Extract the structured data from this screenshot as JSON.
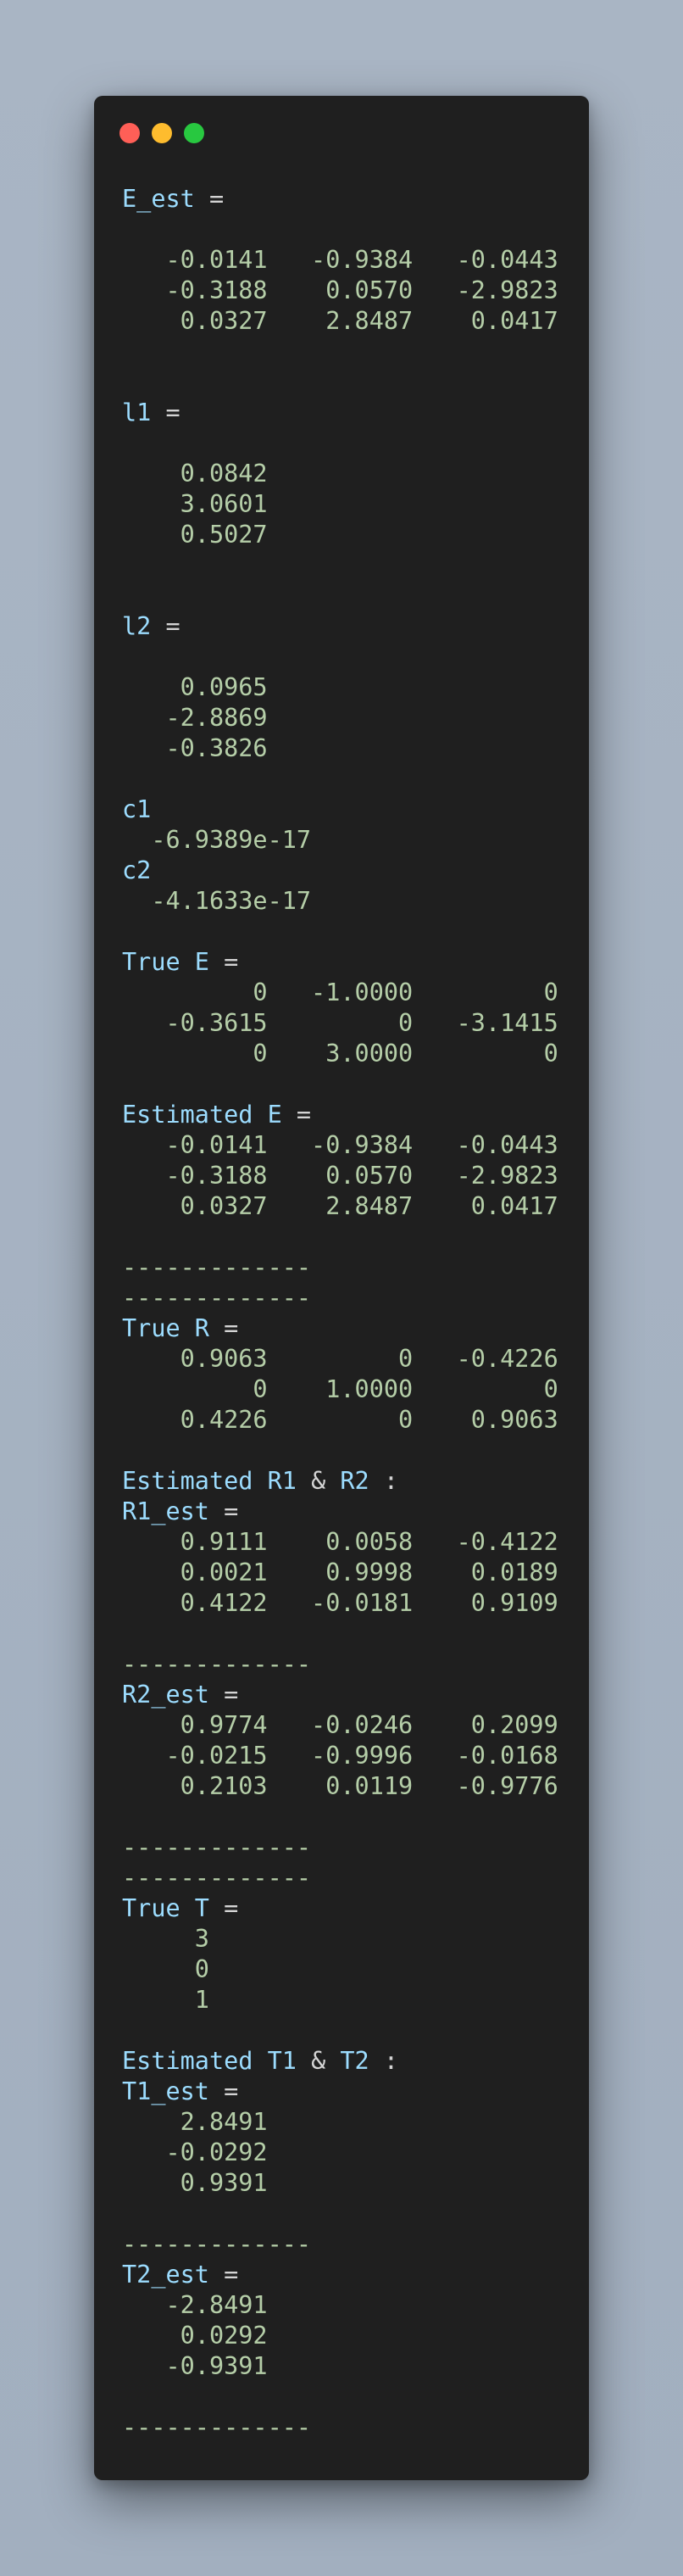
{
  "window": {
    "controls": [
      "close",
      "minimize",
      "zoom"
    ],
    "colors": {
      "close": "#ff5f57",
      "minimize": "#febc2e",
      "zoom": "#28c840"
    }
  },
  "lines": [
    {
      "t": "k",
      "s": "E_est ="
    },
    {
      "t": "b",
      "s": ""
    },
    {
      "t": "v",
      "s": "   -0.0141   -0.9384   -0.0443"
    },
    {
      "t": "v",
      "s": "   -0.3188    0.0570   -2.9823"
    },
    {
      "t": "v",
      "s": "    0.0327    2.8487    0.0417"
    },
    {
      "t": "b",
      "s": ""
    },
    {
      "t": "b",
      "s": ""
    },
    {
      "t": "k",
      "s": "l1 ="
    },
    {
      "t": "b",
      "s": ""
    },
    {
      "t": "v",
      "s": "    0.0842"
    },
    {
      "t": "v",
      "s": "    3.0601"
    },
    {
      "t": "v",
      "s": "    0.5027"
    },
    {
      "t": "b",
      "s": ""
    },
    {
      "t": "b",
      "s": ""
    },
    {
      "t": "k",
      "s": "l2 ="
    },
    {
      "t": "b",
      "s": ""
    },
    {
      "t": "v",
      "s": "    0.0965"
    },
    {
      "t": "v",
      "s": "   -2.8869"
    },
    {
      "t": "v",
      "s": "   -0.3826"
    },
    {
      "t": "b",
      "s": ""
    },
    {
      "t": "k",
      "s": "c1"
    },
    {
      "t": "v",
      "s": "  -6.9389e-17"
    },
    {
      "t": "k",
      "s": "c2"
    },
    {
      "t": "v",
      "s": "  -4.1633e-17"
    },
    {
      "t": "b",
      "s": ""
    },
    {
      "t": "k",
      "s": "True E ="
    },
    {
      "t": "v",
      "s": "         0   -1.0000         0"
    },
    {
      "t": "v",
      "s": "   -0.3615         0   -3.1415"
    },
    {
      "t": "v",
      "s": "         0    3.0000         0"
    },
    {
      "t": "b",
      "s": ""
    },
    {
      "t": "k",
      "s": "Estimated E ="
    },
    {
      "t": "v",
      "s": "   -0.0141   -0.9384   -0.0443"
    },
    {
      "t": "v",
      "s": "   -0.3188    0.0570   -2.9823"
    },
    {
      "t": "v",
      "s": "    0.0327    2.8487    0.0417"
    },
    {
      "t": "b",
      "s": ""
    },
    {
      "t": "v",
      "s": "-------------"
    },
    {
      "t": "v",
      "s": "-------------"
    },
    {
      "t": "k",
      "s": "True R ="
    },
    {
      "t": "v",
      "s": "    0.9063         0   -0.4226"
    },
    {
      "t": "v",
      "s": "         0    1.0000         0"
    },
    {
      "t": "v",
      "s": "    0.4226         0    0.9063"
    },
    {
      "t": "b",
      "s": ""
    },
    {
      "t": "k",
      "s": "Estimated R1 & R2 :"
    },
    {
      "t": "k",
      "s": "R1_est ="
    },
    {
      "t": "v",
      "s": "    0.9111    0.0058   -0.4122"
    },
    {
      "t": "v",
      "s": "    0.0021    0.9998    0.0189"
    },
    {
      "t": "v",
      "s": "    0.4122   -0.0181    0.9109"
    },
    {
      "t": "b",
      "s": ""
    },
    {
      "t": "v",
      "s": "-------------"
    },
    {
      "t": "k",
      "s": "R2_est ="
    },
    {
      "t": "v",
      "s": "    0.9774   -0.0246    0.2099"
    },
    {
      "t": "v",
      "s": "   -0.0215   -0.9996   -0.0168"
    },
    {
      "t": "v",
      "s": "    0.2103    0.0119   -0.9776"
    },
    {
      "t": "b",
      "s": ""
    },
    {
      "t": "v",
      "s": "-------------"
    },
    {
      "t": "v",
      "s": "-------------"
    },
    {
      "t": "k",
      "s": "True T ="
    },
    {
      "t": "v",
      "s": "     3"
    },
    {
      "t": "v",
      "s": "     0"
    },
    {
      "t": "v",
      "s": "     1"
    },
    {
      "t": "b",
      "s": ""
    },
    {
      "t": "k",
      "s": "Estimated T1 & T2 :"
    },
    {
      "t": "k",
      "s": "T1_est ="
    },
    {
      "t": "v",
      "s": "    2.8491"
    },
    {
      "t": "v",
      "s": "   -0.0292"
    },
    {
      "t": "v",
      "s": "    0.9391"
    },
    {
      "t": "b",
      "s": ""
    },
    {
      "t": "v",
      "s": "-------------"
    },
    {
      "t": "k",
      "s": "T2_est ="
    },
    {
      "t": "v",
      "s": "   -2.8491"
    },
    {
      "t": "v",
      "s": "    0.0292"
    },
    {
      "t": "v",
      "s": "   -0.9391"
    },
    {
      "t": "b",
      "s": ""
    },
    {
      "t": "v",
      "s": "-------------"
    }
  ]
}
